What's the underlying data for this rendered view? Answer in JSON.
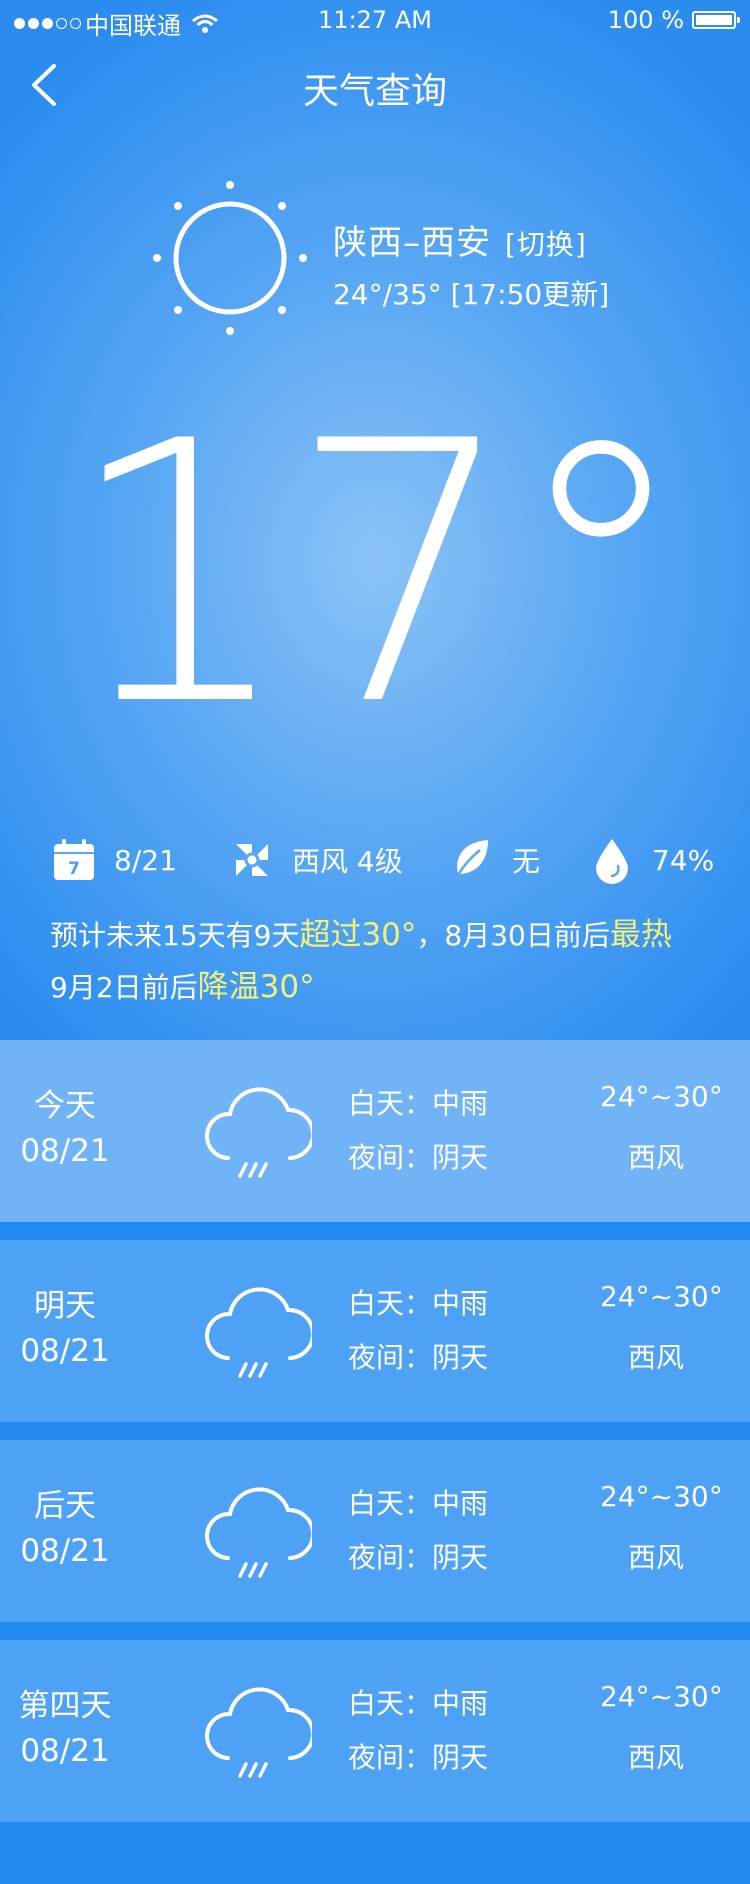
{
  "status": {
    "carrier": "中国联通",
    "time": "11:27 AM",
    "battery": "100 %"
  },
  "nav": {
    "title": "天气查询"
  },
  "location": {
    "city": "陕西–西安",
    "switch": "[切换]",
    "range": "24°/35° [17:50更新]"
  },
  "current_temp": "17°",
  "info": {
    "date": "8/21",
    "wind": "西风 4级",
    "rain": "无",
    "humidity": "74%",
    "calendar_day": "7"
  },
  "tip": {
    "a": "预计未来15天有9天",
    "b": "超过30°",
    "c": "，8月30日前后",
    "d": "最热",
    "e": "9月2日前后",
    "f": "降温30°"
  },
  "forecast": [
    {
      "day": "今天",
      "date": "08/21",
      "day_weather": "白天：中雨",
      "night_weather": "夜间：阴天",
      "temp": "24°~30°",
      "wind": "西风"
    },
    {
      "day": "明天",
      "date": "08/21",
      "day_weather": "白天：中雨",
      "night_weather": "夜间：阴天",
      "temp": "24°~30°",
      "wind": "西风"
    },
    {
      "day": "后天",
      "date": "08/21",
      "day_weather": "白天：中雨",
      "night_weather": "夜间：阴天",
      "temp": "24°~30°",
      "wind": "西风"
    },
    {
      "day": "第四天",
      "date": "08/21",
      "day_weather": "白天：中雨",
      "night_weather": "夜间：阴天",
      "temp": "24°~30°",
      "wind": "西风"
    }
  ],
  "colors": {
    "highlight": "#f5f07a",
    "card1": "#70b3f6",
    "card_other": "#4ea2f5",
    "separator": "#2189ef"
  },
  "icons": {
    "back": "chevron-left-icon",
    "sun": "sun-icon",
    "calendar": "calendar-icon",
    "wind": "pinwheel-icon",
    "leaf": "leaf-icon",
    "drop": "water-drop-icon",
    "rain": "rain-cloud-icon"
  }
}
